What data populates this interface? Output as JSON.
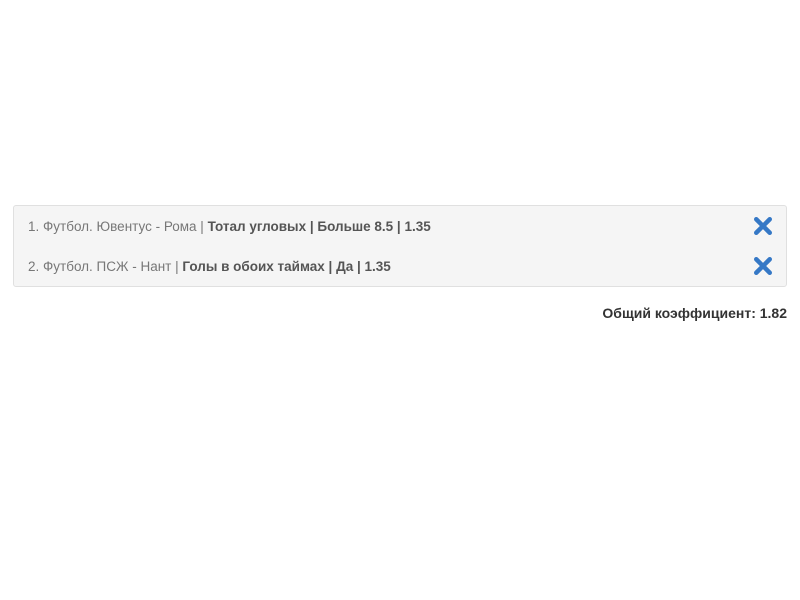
{
  "bets": [
    {
      "prefix": "1. Футбол. Ювентус - Рома | ",
      "market": "Тотал угловых",
      "sep1": " | ",
      "selection": "Больше 8.5",
      "sep2": " | ",
      "odds": "1.35"
    },
    {
      "prefix": "2. Футбол. ПСЖ - Нант | ",
      "market": "Голы в обоих таймах",
      "sep1": " | ",
      "selection": "Да",
      "sep2": " | ",
      "odds": "1.35"
    }
  ],
  "total_label": "Общий коэффициент: ",
  "total_value": "1.82",
  "accent_color": "#3578c6"
}
